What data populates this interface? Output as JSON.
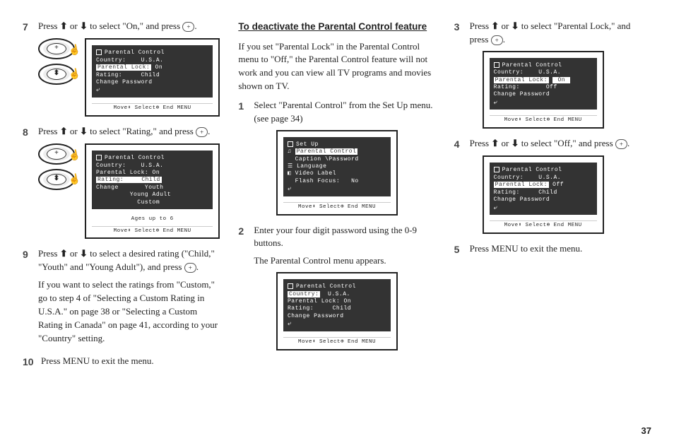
{
  "page_number": "37",
  "col1": {
    "step7": {
      "num": "7",
      "text_a": "Press ",
      "text_b": " or ",
      "text_c": " to select \"On,\" and press ",
      "text_d": "."
    },
    "screen7": {
      "l1": "Parental Control",
      "l2": "Country:    U.S.A.",
      "l3_hl": "Parental Lock:",
      "l3_v": " On",
      "l4": "Rating:     Child",
      "l5": "Change Password",
      "footer": "Move⬍  Select⊕  End MENU"
    },
    "step8": {
      "num": "8",
      "text_a": "Press ",
      "text_b": " or ",
      "text_c": " to select \"Rating,\" and press ",
      "text_d": "."
    },
    "screen8": {
      "l1": "Parental Control",
      "l2": "Country:    U.S.A.",
      "l3": "Parental Lock: On",
      "l4_hl": "Rating:",
      "l4_v": "    Child",
      "l5": "Change       Youth",
      "l6": "         Young Adult",
      "l7": "           Custom",
      "note": "Ages up to 6",
      "footer": "Move⬍  Select⊕  End MENU"
    },
    "step9": {
      "num": "9",
      "text_a": "Press ",
      "text_b": " or ",
      "text_c": " to select a desired rating (\"Child,\" \"Youth\" and \"Young Adult\"), and press ",
      "text_d": ".",
      "para2": "If you want to select the ratings from \"Custom,\" go to step 4 of \"Selecting a Custom Rating in U.S.A.\" on page 38 or \"Selecting a Custom Rating in Canada\" on page 41, according to your \"Country\" setting."
    },
    "step10": {
      "num": "10",
      "text": "Press MENU to exit the menu."
    }
  },
  "col2": {
    "heading": "To deactivate the Parental Control feature",
    "intro": "If you set \"Parental Lock\" in the Parental Control menu to \"Off,\" the Parental Control feature will not work and you can view all TV programs and movies shown on TV.",
    "step1": {
      "num": "1",
      "text": "Select \"Parental Control\" from the Set Up menu. (see page 34)"
    },
    "screen1": {
      "l1": "Set Up",
      "l2_hl": "Parental Control",
      "l3": "Caption \\Password",
      "l4": "Language",
      "l5": "Video Label",
      "l6": "Flash Focus:   No",
      "footer": "Move⬍  Select⊕  End MENU"
    },
    "step2": {
      "num": "2",
      "text": "Enter your four digit password using the 0-9 buttons.",
      "sub": "The Parental Control menu appears."
    },
    "screen2": {
      "l1": "Parental Control",
      "l2_hl": "Country:",
      "l2_v": "  U.S.A.",
      "l3": "Parental Lock: On",
      "l4": "Rating:     Child",
      "l5": "Change Password",
      "footer": "Move⬍  Select⊕  End MENU"
    }
  },
  "col3": {
    "step3": {
      "num": "3",
      "text_a": "Press ",
      "text_b": " or ",
      "text_c": " to select \"Parental Lock,\" and press ",
      "text_d": "."
    },
    "screen3": {
      "l1": "Parental Control",
      "l2": "Country:    U.S.A.",
      "l3_hl": "Parental Lock:",
      "l3_v_hl": " On ",
      "l4": "Rating:       Off",
      "l5": "Change Password",
      "footer": "Move⬍  Select⊕  End MENU"
    },
    "step4": {
      "num": "4",
      "text_a": "Press ",
      "text_b": " or ",
      "text_c": " to select \"Off,\" and press ",
      "text_d": "."
    },
    "screen4": {
      "l1": "Parental Control",
      "l2": "Country:    U.S.A.",
      "l3_hl": "Parental Lock:",
      "l3_v": " Off",
      "l4": "Rating:     Child",
      "l5": "Change Password",
      "footer": "Move⬍  Select⊕  End MENU"
    },
    "step5": {
      "num": "5",
      "text": "Press MENU to exit the menu."
    }
  },
  "glyph": {
    "up": "⬆",
    "down": "⬇",
    "plus": "+"
  }
}
